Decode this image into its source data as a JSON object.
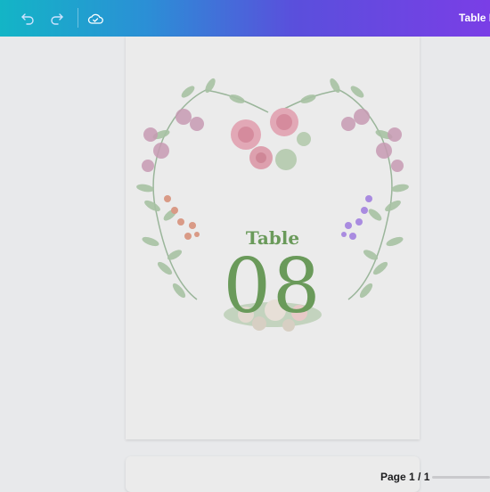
{
  "topbar": {
    "undo_icon": "undo-icon",
    "redo_icon": "redo-icon",
    "cloud_icon": "cloud-check-icon",
    "doc_title": "Table N"
  },
  "design": {
    "label": "Table",
    "number": "08",
    "accent_color": "#6a9a5a"
  },
  "footer": {
    "page_indicator": "Page 1 / 1"
  }
}
